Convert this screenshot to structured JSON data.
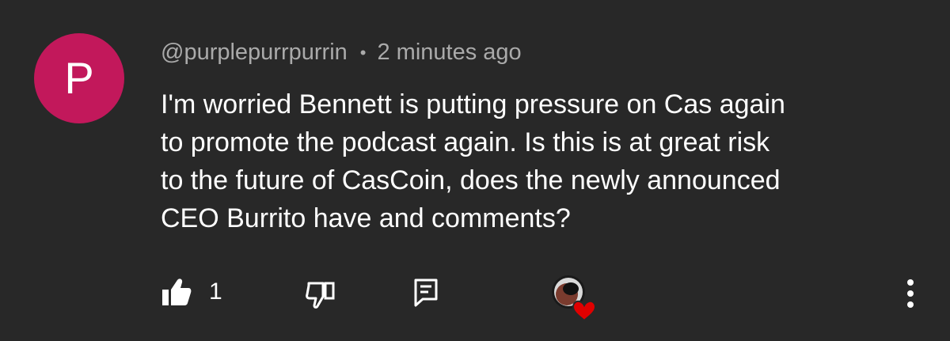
{
  "comment": {
    "avatar_letter": "P",
    "avatar_color": "#c2185b",
    "author_handle": "@purplepurrpurrin",
    "separator": "•",
    "timestamp": "2 minutes ago",
    "body_lines": [
      "I'm worried Bennett is putting pressure on Cas again",
      "to promote the podcast again. Is this is at great risk",
      "to the future of CasCoin, does the newly announced",
      "CEO Burrito have and comments?"
    ]
  },
  "actions": {
    "like_count": "1",
    "icons": {
      "like": "thumbs-up-icon",
      "dislike": "thumbs-down-icon",
      "reply": "reply-icon",
      "creator_heart": "creator-heart-icon",
      "menu": "more-vert-icon"
    },
    "heart_color": "#e00000"
  }
}
